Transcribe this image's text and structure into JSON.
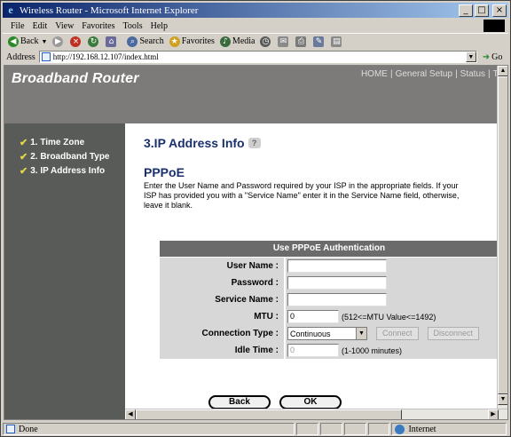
{
  "window": {
    "title": "Wireless Router - Microsoft Internet Explorer",
    "buttons": [
      "_",
      "□",
      "×"
    ]
  },
  "menu": [
    "File",
    "Edit",
    "View",
    "Favorites",
    "Tools",
    "Help"
  ],
  "toolbar": {
    "back": "Back",
    "search": "Search",
    "favorites": "Favorites",
    "media": "Media"
  },
  "address": {
    "label": "Address",
    "url": "http://192.168.12.107/index.html",
    "go": "Go"
  },
  "header": {
    "brand": "Broadband Router",
    "nav": [
      "HOME",
      "General Setup",
      "Status",
      "Tool"
    ]
  },
  "sidebar": {
    "items": [
      "1. Time Zone",
      "2. Broadband Type",
      "3. IP Address Info"
    ]
  },
  "page": {
    "title": "3.IP Address Info",
    "section": "PPPoE",
    "description": "Enter the User Name and Password required by your ISP in the appropriate fields. If your ISP has provided you with a \"Service Name\" enter it in the Service Name field, otherwise, leave it blank."
  },
  "form": {
    "header": "Use PPPoE Authentication",
    "user_name": {
      "label": "User Name :",
      "value": ""
    },
    "password": {
      "label": "Password :",
      "value": ""
    },
    "service_name": {
      "label": "Service Name :",
      "value": ""
    },
    "mtu": {
      "label": "MTU :",
      "value": "0",
      "hint": "(512<=MTU Value<=1492)"
    },
    "connection_type": {
      "label": "Connection Type :",
      "value": "Continuous",
      "connect": "Connect",
      "disconnect": "Disconnect"
    },
    "idle_time": {
      "label": "Idle Time :",
      "value": "0",
      "hint": "(1-1000 minutes)"
    }
  },
  "actions": {
    "back": "Back",
    "ok": "OK"
  },
  "status": {
    "text": "Done",
    "zone": "Internet"
  },
  "colors": {
    "header": "#7d7b7a",
    "sidebar": "#595b58",
    "title": "#1a2f6e",
    "form_header": "#6b6b6b",
    "form_row": "#d7d7d7"
  }
}
